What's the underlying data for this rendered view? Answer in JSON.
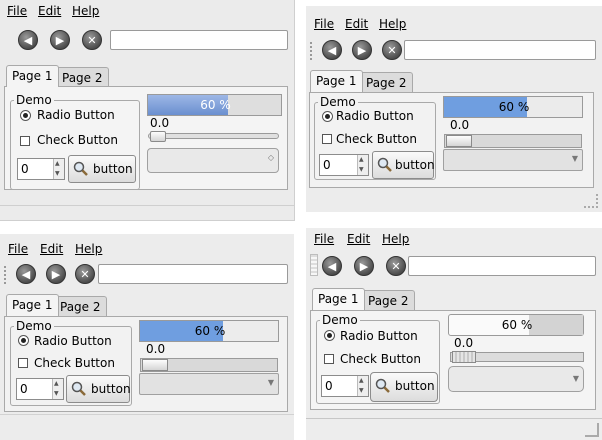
{
  "menu": {
    "file": "File",
    "edit": "Edit",
    "help": "Help"
  },
  "tabs": {
    "page1": "Page 1",
    "page2": "Page 2"
  },
  "group": {
    "title": "Demo",
    "radio_label": "Radio Button",
    "check_label": "Check Button"
  },
  "spin": {
    "value": "0"
  },
  "button": {
    "label": "button"
  },
  "progress": {
    "text": "60 %",
    "value": 0.6
  },
  "slider": {
    "value_label": "0.0"
  },
  "icons": {
    "back": "back-arrow-icon",
    "forward": "forward-arrow-icon",
    "stop": "stop-x-icon",
    "search": "magnifier-icon"
  },
  "colors": {
    "progress_fill_1": "#7b9bd1",
    "progress_fill_2": "#6f9ee0",
    "progress_fill_3": "#6f9ee0",
    "panel_bg": "#ececec"
  },
  "themes": [
    {
      "name": "theme-1"
    },
    {
      "name": "theme-2"
    },
    {
      "name": "theme-3"
    },
    {
      "name": "theme-4"
    }
  ]
}
